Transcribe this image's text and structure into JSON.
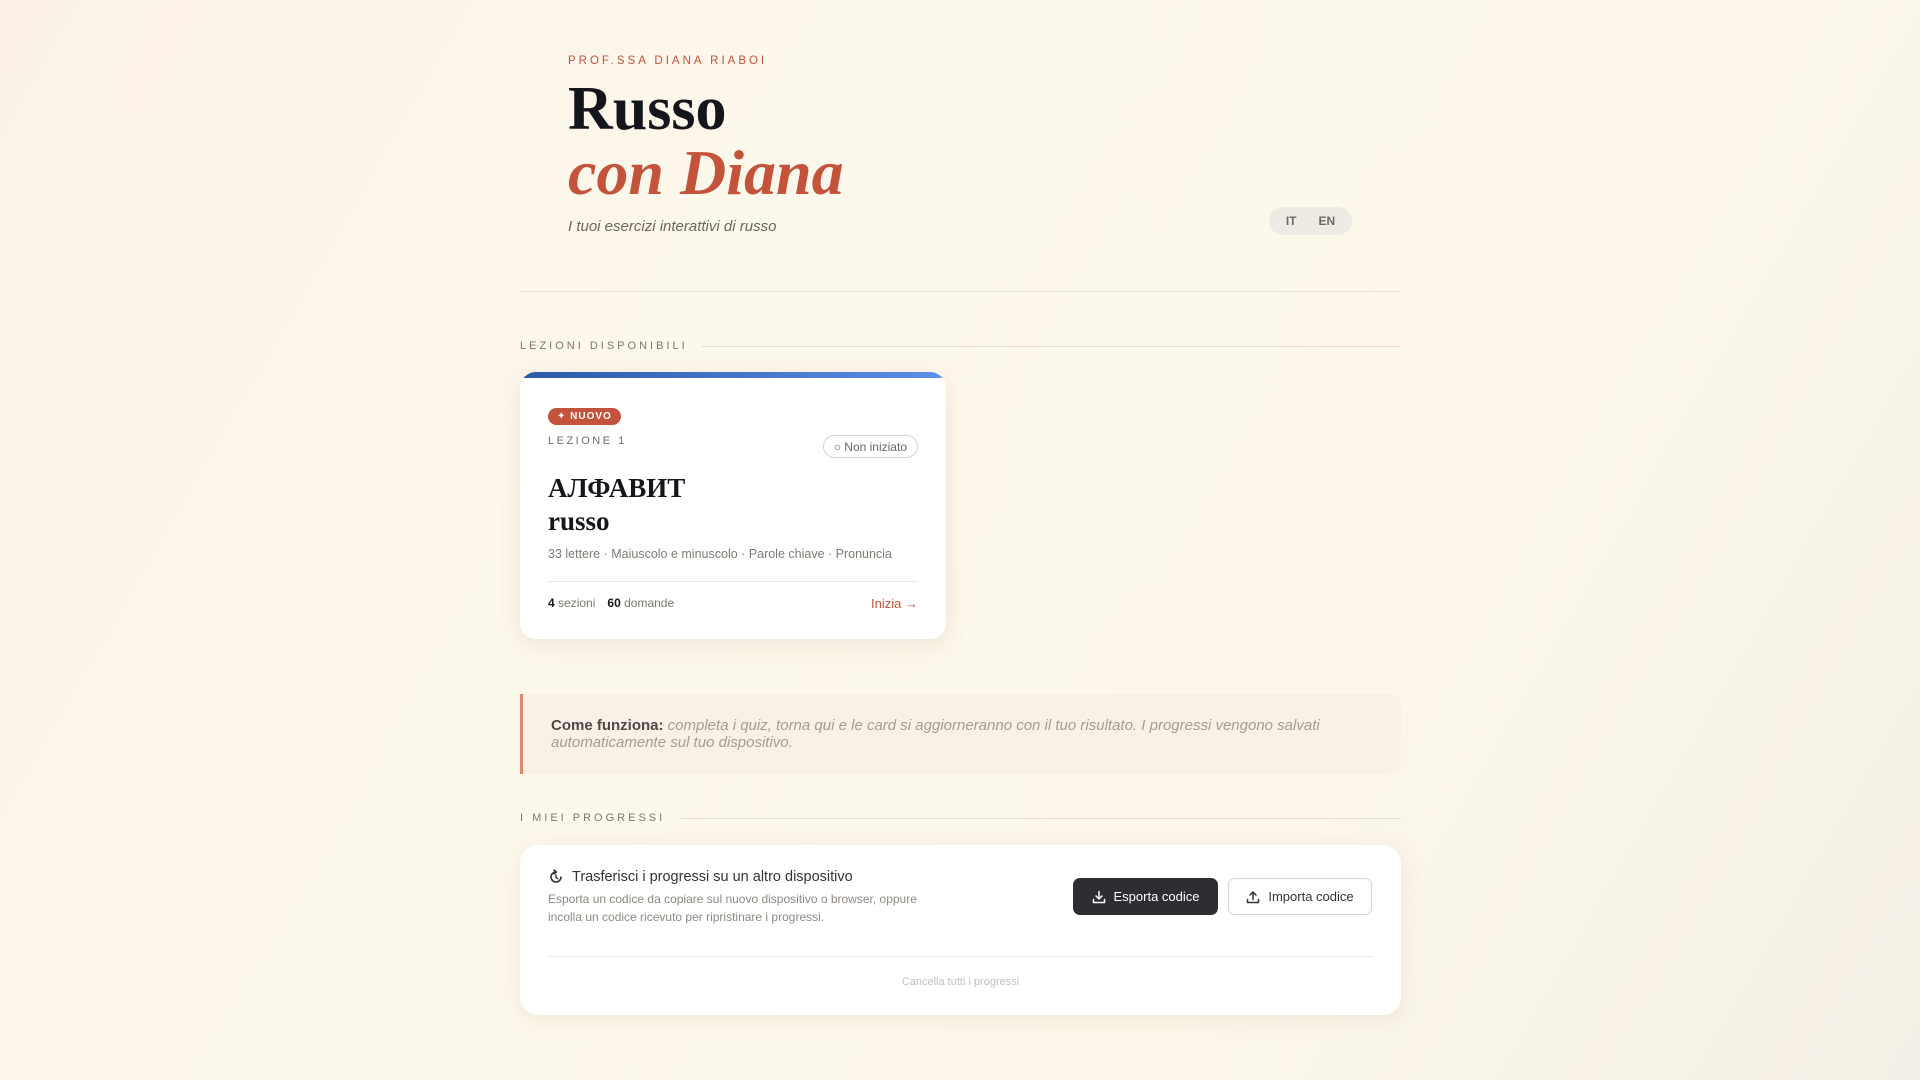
{
  "header": {
    "eyebrow": "PROF.SSA DIANA RIABOI",
    "title_line1": "Russo",
    "title_line2": "con Diana",
    "subtitle": "I tuoi esercizi interattivi di russo",
    "languages": [
      "IT",
      "EN"
    ]
  },
  "lessons_section": {
    "label": "LEZIONI DISPONIBILI",
    "lessons": [
      {
        "badge": "✦ NUOVO",
        "tag": "LEZIONE 1",
        "status": "○ Non iniziato",
        "title_line1": "АЛФАВИТ",
        "title_line2": "russo",
        "description": "33 lettere · Maiuscolo e minuscolo · Parole chiave · Pronuncia",
        "sections_count": "4",
        "sections_label": "sezioni",
        "questions_count": "60",
        "questions_label": "domande",
        "start_label": "Inizia →"
      }
    ]
  },
  "callout": {
    "lead": "Come funziona:",
    "text": "completa i quiz, torna qui e le card si aggiorneranno con il tuo risultato. I progressi vengono salvati automaticamente sul tuo dispositivo."
  },
  "progress_section": {
    "label": "I MIEI PROGRESSI",
    "title": "Trasferisci i progressi su un altro dispositivo",
    "description": "Esporta un codice da copiare sul nuovo dispositivo o browser, oppure incolla un codice ricevuto per ripristinare i progressi.",
    "export_label": "Esporta codice",
    "import_label": "Importa codice",
    "clear_label": "Cancella tutti i progressi"
  },
  "colors": {
    "accent": "#c4533b",
    "dark_button": "#2e2d32",
    "lesson_bar_start": "#2c5aa8",
    "lesson_bar_end": "#5c8fe6"
  }
}
